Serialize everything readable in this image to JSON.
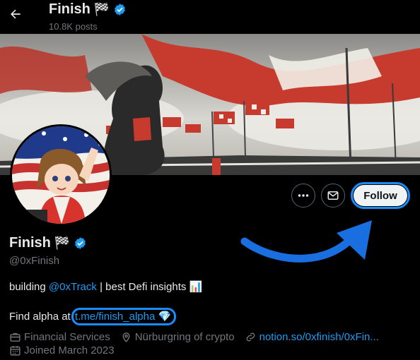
{
  "header": {
    "back_label": "←",
    "name": "Finish",
    "flag": "🏁",
    "posts": "10.8K posts"
  },
  "actions": {
    "more_label": "···",
    "follow_label": "Follow"
  },
  "profile": {
    "name": "Finish",
    "flag": "🏁",
    "handle": "@0xFinish",
    "bio_prefix": "building ",
    "bio_mention": "@0xTrack",
    "bio_suffix": " | best Defi insights 📊",
    "alpha_prefix": "Find alpha at ",
    "alpha_link": "t.me/finish_alpha",
    "alpha_emoji": "💎",
    "category": "Financial Services",
    "location": "Nürburgring of crypto",
    "website": "notion.so/0xfinish/0xFin...",
    "joined": "Joined March 2023"
  },
  "colors": {
    "accent": "#1d9bf0",
    "highlight": "#1a8cff",
    "muted": "#71767b",
    "text": "#e7e9ea"
  },
  "icons": [
    "back-arrow-icon",
    "verified-badge-icon",
    "more-icon",
    "message-icon",
    "briefcase-icon",
    "location-pin-icon",
    "link-icon",
    "calendar-icon",
    "curved-arrow-annotation"
  ]
}
